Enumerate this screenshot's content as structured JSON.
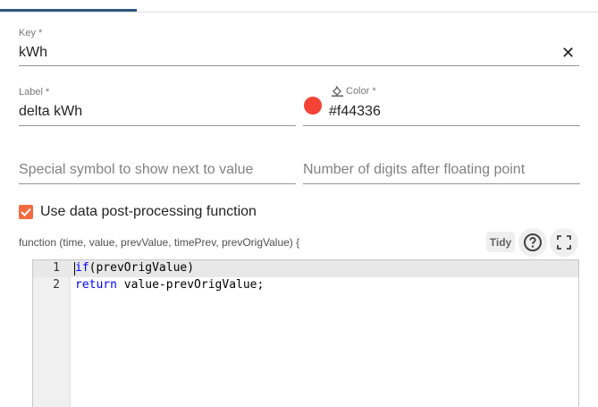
{
  "key": {
    "label": "Key *",
    "value": "kWh",
    "clear_icon": "close-icon"
  },
  "label_field": {
    "label": "Label *",
    "value": "delta kWh"
  },
  "color": {
    "label": "Color *",
    "value": "#f44336",
    "swatch": "#f44336",
    "icon": "format-color-fill-icon"
  },
  "units": {
    "placeholder": "Special symbol to show next to value"
  },
  "decimals": {
    "placeholder": "Number of digits after floating point"
  },
  "post_processing": {
    "checked": true,
    "label": "Use data post-processing function",
    "signature": "function (time, value, prevValue, timePrev, prevOrigValue) {",
    "tidy_label": "Tidy",
    "help_icon": "help-circle-icon",
    "fullscreen_icon": "fullscreen-icon"
  },
  "editor": {
    "lines": [
      {
        "number": "1",
        "keyword": "if",
        "rest": "(prevOrigValue)"
      },
      {
        "number": "2",
        "keyword": "return",
        "rest": " value-prevOrigValue;"
      }
    ]
  },
  "colors": {
    "accent": "#305680",
    "checkbox": "#f26a3f",
    "keyword": "#0000ff"
  }
}
